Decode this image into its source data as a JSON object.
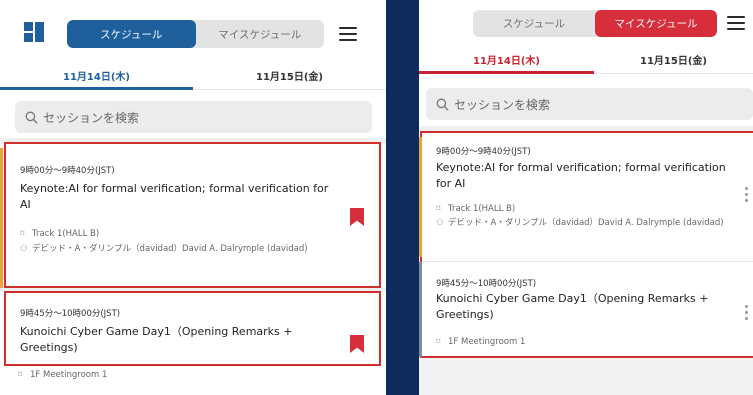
{
  "left": {
    "tabs": {
      "schedule": "スケジュール",
      "my_schedule": "マイスケジュール"
    },
    "dates": {
      "day1": "11月14日(木)",
      "day2": "11月15日(金)"
    },
    "search": {
      "placeholder": "セッションを検索"
    },
    "sessions": [
      {
        "time": "9時00分〜9時40分(JST)",
        "title": "Keynote:AI for formal verification; formal verification for AI",
        "track": "Track 1(HALL B)",
        "speaker": "デビッド・A・ダリンプル（davidad）David A. Dalrymple (davidad)"
      },
      {
        "time": "9時45分〜10時00分(JST)",
        "title": "Kunoichi Cyber Game Day1（Opening Remarks + Greetings)",
        "track": "1F Meetingroom 1"
      }
    ]
  },
  "right": {
    "tabs": {
      "schedule": "スケジュール",
      "my_schedule": "マイスケジュール"
    },
    "dates": {
      "day1": "11月14日(木)",
      "day2": "11月15日(金)"
    },
    "search": {
      "placeholder": "セッションを検索"
    },
    "sessions": [
      {
        "time": "9時00分〜9時40分(JST)",
        "title": "Keynote:AI for formal verification; formal verification for AI",
        "track": "Track 1(HALL B)",
        "speaker": "デビッド・A・ダリンプル（davidad）David A. Dalrymple (davidad)"
      },
      {
        "time": "9時45分〜10時00分(JST)",
        "title": "Kunoichi Cyber Game Day1（Opening Remarks + Greetings)",
        "track": "1F Meetingroom 1"
      }
    ]
  },
  "colors": {
    "background": "#0f2a5c",
    "brand_blue": "#1f5f9c",
    "accent_red": "#d62f3b",
    "highlight_outline": "#d0302c"
  },
  "icons": [
    "app-logo-icon",
    "menu-icon",
    "search-icon",
    "bookmark-icon",
    "location-icon",
    "person-icon",
    "more-vertical-icon"
  ]
}
